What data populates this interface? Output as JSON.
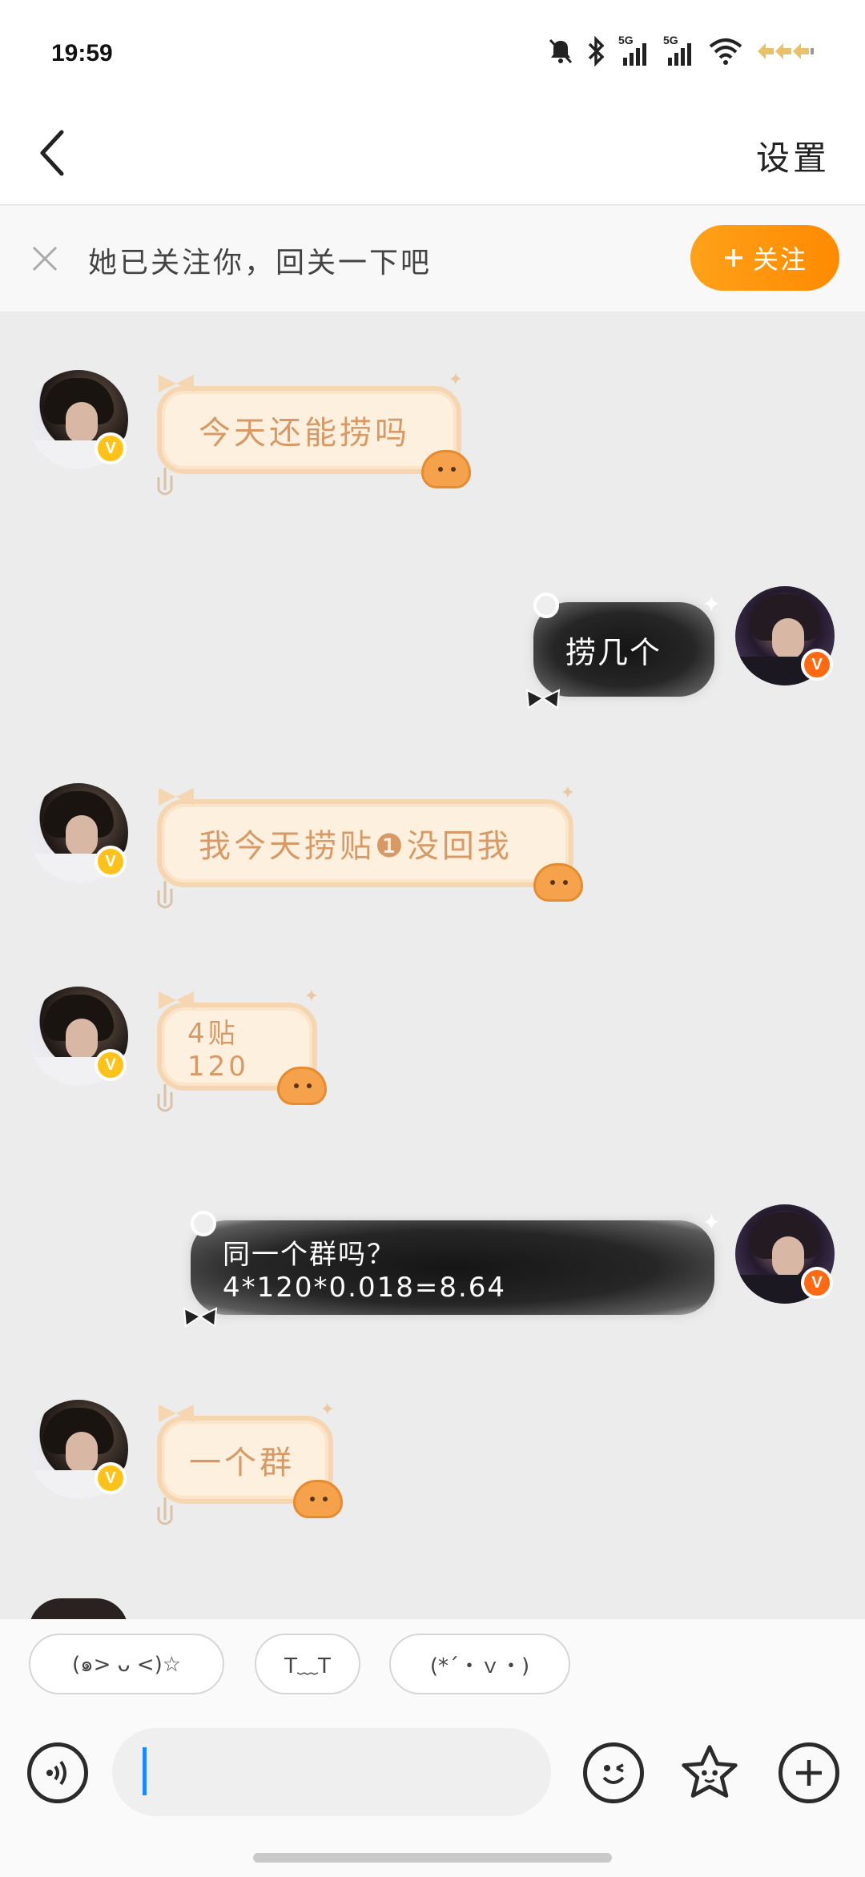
{
  "status_bar": {
    "time": "19:59",
    "net1_label": "5G",
    "net2_label": "5G"
  },
  "nav": {
    "title": "",
    "settings_label": "设置"
  },
  "follow_banner": {
    "text": "她已关注你，回关一下吧",
    "button_label": "关注",
    "button_icon": "plus-icon"
  },
  "messages": [
    {
      "side": "in",
      "text": "今天还能捞吗"
    },
    {
      "side": "out",
      "text": "捞几个"
    },
    {
      "side": "in",
      "text": "我今天捞贴❶没回我"
    },
    {
      "side": "in",
      "text": "4贴120"
    },
    {
      "side": "out",
      "text": "同一个群吗？ 4*120*0.018=8.64"
    },
    {
      "side": "in",
      "text": "一个群"
    }
  ],
  "quick_replies": [
    "(๑> ᴗ <)☆",
    "T﹏T",
    "(*´・ｖ・)"
  ],
  "input": {
    "value": "",
    "placeholder": ""
  },
  "colors": {
    "accent": "#ff8a00",
    "badge_gold": "#ffc21a",
    "badge_orange": "#ff6a13",
    "bubble_in_text": "#d79a66",
    "caret": "#1e88ff"
  }
}
